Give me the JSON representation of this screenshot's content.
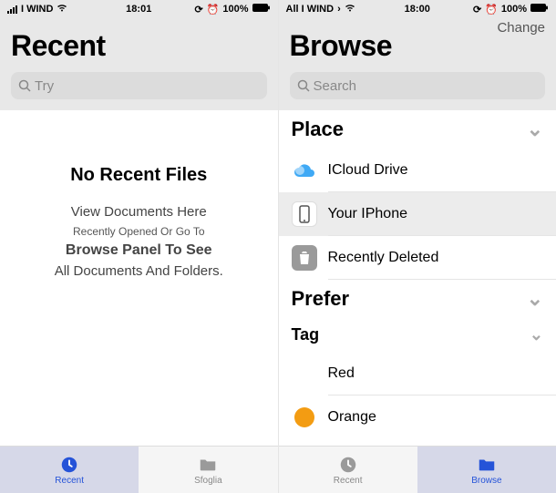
{
  "left": {
    "status": {
      "carrier": "I WIND",
      "time": "18:01",
      "battery": "100%"
    },
    "title": "Recent",
    "search": {
      "placeholder": "Try"
    },
    "empty": {
      "heading": "No Recent Files",
      "line1": "View Documents Here",
      "line2": "Recently Opened Or Go To",
      "line3": "Browse Panel To See",
      "line4": "All Documents And Folders."
    },
    "tabs": [
      {
        "label": "Recent",
        "icon": "clock-icon",
        "active": true
      },
      {
        "label": "Sfoglia",
        "icon": "folder-icon",
        "active": false
      }
    ]
  },
  "right": {
    "status": {
      "carrier": "All I WIND",
      "time": "18:00",
      "battery": "100%"
    },
    "change": "Change",
    "title": "Browse",
    "search": {
      "placeholder": "Search"
    },
    "sections": {
      "place": {
        "heading": "Place",
        "items": [
          {
            "label": "ICloud Drive",
            "icon": "cloud-icon",
            "selected": false
          },
          {
            "label": "Your IPhone",
            "icon": "phone-icon",
            "selected": true
          },
          {
            "label": "Recently Deleted",
            "icon": "trash-icon",
            "selected": false
          }
        ]
      },
      "prefer": {
        "heading": "Prefer"
      },
      "tag": {
        "heading": "Tag",
        "items": [
          {
            "label": "Red",
            "color": "#e6332a"
          },
          {
            "label": "Orange",
            "color": "#f39c12"
          }
        ]
      }
    },
    "tabs": [
      {
        "label": "Recent",
        "icon": "clock-icon",
        "active": false
      },
      {
        "label": "Browse",
        "icon": "folder-icon",
        "active": true
      }
    ]
  }
}
